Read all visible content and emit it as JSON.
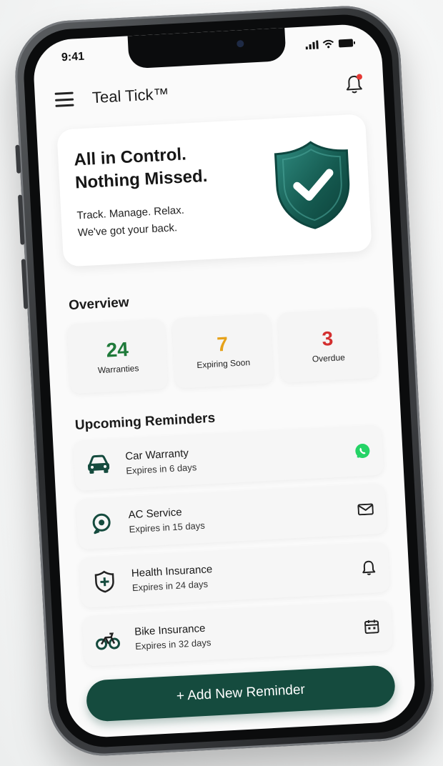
{
  "status_bar": {
    "time": "9:41"
  },
  "header": {
    "app_title": "Teal Tick™"
  },
  "hero": {
    "title_line1": "All in Control.",
    "title_line2": "Nothing Missed.",
    "subtitle_line1": "Track. Manage. Relax.",
    "subtitle_line2": "We've got your back."
  },
  "overview": {
    "title": "Overview",
    "stats": [
      {
        "value": "24",
        "label": "Warranties",
        "color": "#1f7a3a"
      },
      {
        "value": "7",
        "label": "Expiring Soon",
        "color": "#e6a21a"
      },
      {
        "value": "3",
        "label": "Overdue",
        "color": "#d32f2f"
      }
    ]
  },
  "reminders": {
    "title": "Upcoming Reminders",
    "items": [
      {
        "name": "Car Warranty",
        "expires": "Expires in 6 days",
        "icon": "car-icon",
        "action_icon": "whatsapp-icon"
      },
      {
        "name": "AC Service",
        "expires": "Expires in 15 days",
        "icon": "ac-service-icon",
        "action_icon": "mail-icon"
      },
      {
        "name": "Health Insurance",
        "expires": "Expires in 24 days",
        "icon": "health-shield-icon",
        "action_icon": "bell-icon"
      },
      {
        "name": "Bike Insurance",
        "expires": "Expires in 32 days",
        "icon": "bike-icon",
        "action_icon": "calendar-icon"
      }
    ]
  },
  "add_button": {
    "label": "+ Add New Reminder"
  },
  "colors": {
    "brand": "#154b3e",
    "shield": "#1d5e55",
    "whatsapp": "#25d366",
    "notification_dot": "#e53935"
  }
}
